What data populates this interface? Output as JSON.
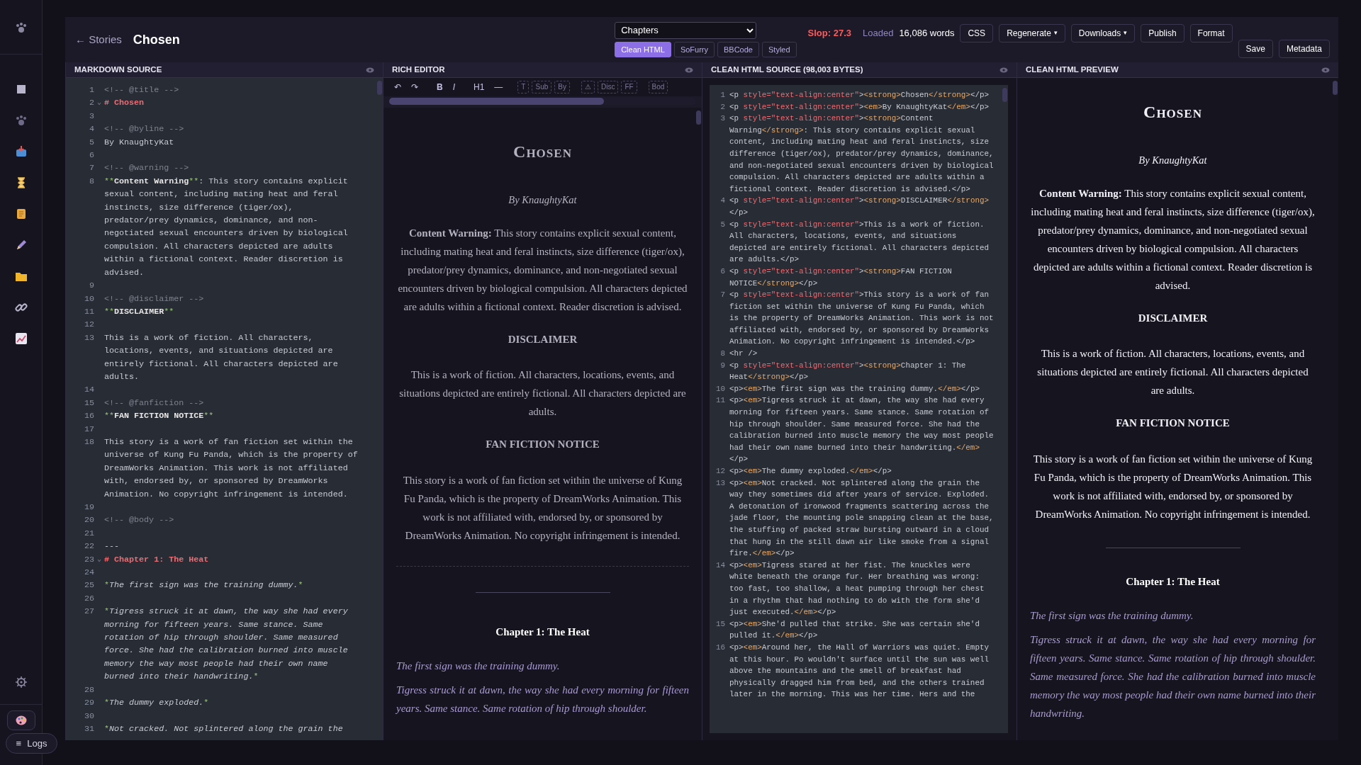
{
  "header": {
    "back_link": "← Stories",
    "title": "Chosen",
    "format_select": "Chapters",
    "format_tabs": [
      {
        "label": "Clean HTML",
        "selected": true
      },
      {
        "label": "SoFurry",
        "selected": false
      },
      {
        "label": "BBCode",
        "selected": false
      },
      {
        "label": "Styled",
        "selected": false
      }
    ],
    "slop": "Slop: 27.3",
    "status": "Loaded",
    "word_count": "16,086 words",
    "buttons": [
      {
        "label": "CSS"
      },
      {
        "label": "Regenerate",
        "caret": "▾"
      },
      {
        "label": "Downloads",
        "caret": "▾"
      },
      {
        "label": "Publish"
      },
      {
        "label": "Format"
      }
    ],
    "end_buttons": [
      {
        "label": "Save"
      },
      {
        "label": "Metadata"
      }
    ]
  },
  "sidebar": {
    "logs_icon": "≡",
    "logs_label": "Logs"
  },
  "markdown": {
    "title": "MARKDOWN SOURCE",
    "lines": [
      {
        "n": "1",
        "parts": [
          {
            "kind": "comment",
            "text": "<!-- @title -->"
          }
        ]
      },
      {
        "n": "2",
        "fold": "⌄",
        "parts": [
          {
            "kind": "h",
            "text": "# Chosen"
          }
        ]
      },
      {
        "n": "3"
      },
      {
        "n": "4",
        "parts": [
          {
            "kind": "comment",
            "text": "<!-- @byline -->"
          }
        ]
      },
      {
        "n": "5",
        "parts": [
          {
            "kind": "text",
            "text": "By KnaughtyKat"
          }
        ]
      },
      {
        "n": "6"
      },
      {
        "n": "7",
        "parts": [
          {
            "kind": "comment",
            "text": "<!-- @warning -->"
          }
        ]
      },
      {
        "n": "8",
        "parts": [
          {
            "kind": "mark",
            "text": "**"
          },
          {
            "kind": "strong",
            "text": "Content Warning"
          },
          {
            "kind": "mark",
            "text": "**"
          },
          {
            "kind": "text",
            "text": ": This story contains explicit sexual content, including mating heat and feral instincts, size difference (tiger/ox), predator/prey dynamics, dominance, and non-negotiated sexual encounters driven by biological compulsion. All characters depicted are adults within a fictional context. Reader discretion is advised."
          }
        ]
      },
      {
        "n": "9"
      },
      {
        "n": "10",
        "parts": [
          {
            "kind": "comment",
            "text": "<!-- @disclaimer -->"
          }
        ]
      },
      {
        "n": "11",
        "parts": [
          {
            "kind": "mark",
            "text": "**"
          },
          {
            "kind": "strong",
            "text": "DISCLAIMER"
          },
          {
            "kind": "mark",
            "text": "**"
          }
        ]
      },
      {
        "n": "12"
      },
      {
        "n": "13",
        "parts": [
          {
            "kind": "text",
            "text": "This is a work of fiction. All characters, locations, events, and situations depicted are entirely fictional. All characters depicted are adults."
          }
        ]
      },
      {
        "n": "14"
      },
      {
        "n": "15",
        "parts": [
          {
            "kind": "comment",
            "text": "<!-- @fanfiction -->"
          }
        ]
      },
      {
        "n": "16",
        "parts": [
          {
            "kind": "mark",
            "text": "**"
          },
          {
            "kind": "strong",
            "text": "FAN FICTION NOTICE"
          },
          {
            "kind": "mark",
            "text": "**"
          }
        ]
      },
      {
        "n": "17"
      },
      {
        "n": "18",
        "parts": [
          {
            "kind": "text",
            "text": "This story is a work of fan fiction set within the universe of Kung Fu Panda, which is the property of DreamWorks Animation. This work is not affiliated with, endorsed by, or sponsored by DreamWorks Animation. No copyright infringement is intended."
          }
        ]
      },
      {
        "n": "19"
      },
      {
        "n": "20",
        "parts": [
          {
            "kind": "comment",
            "text": "<!-- @body -->"
          }
        ]
      },
      {
        "n": "21"
      },
      {
        "n": "22",
        "parts": [
          {
            "kind": "text",
            "text": "---"
          }
        ]
      },
      {
        "n": "23",
        "fold": "⌄",
        "parts": [
          {
            "kind": "h",
            "text": "# Chapter 1: The Heat"
          }
        ]
      },
      {
        "n": "24"
      },
      {
        "n": "25",
        "parts": [
          {
            "kind": "mark",
            "text": "*"
          },
          {
            "kind": "em",
            "text": "The first sign was the training dummy."
          },
          {
            "kind": "mark",
            "text": "*"
          }
        ]
      },
      {
        "n": "26"
      },
      {
        "n": "27",
        "parts": [
          {
            "kind": "mark",
            "text": "*"
          },
          {
            "kind": "em",
            "text": "Tigress struck it at dawn, the way she had every morning for fifteen years. Same stance. Same rotation of hip through shoulder. Same measured force. She had the calibration burned into muscle memory the way most people had their own name burned into their handwriting."
          },
          {
            "kind": "mark",
            "text": "*"
          }
        ]
      },
      {
        "n": "28"
      },
      {
        "n": "29",
        "parts": [
          {
            "kind": "mark",
            "text": "*"
          },
          {
            "kind": "em",
            "text": "The dummy exploded."
          },
          {
            "kind": "mark",
            "text": "*"
          }
        ]
      },
      {
        "n": "30"
      },
      {
        "n": "31",
        "parts": [
          {
            "kind": "mark",
            "text": "*"
          },
          {
            "kind": "em",
            "text": "Not cracked. Not splintered along the grain the"
          }
        ]
      }
    ]
  },
  "rich_editor": {
    "title": "RICH EDITOR",
    "toolbar": [
      [
        {
          "label": "↶",
          "kind": "plain"
        },
        {
          "label": "↷",
          "kind": "plain"
        }
      ],
      [
        {
          "label": "B",
          "kind": "bold"
        },
        {
          "label": "I",
          "kind": "italic"
        }
      ],
      [
        {
          "label": "H1",
          "kind": "plain"
        },
        {
          "label": "—",
          "kind": "plain"
        }
      ],
      [
        {
          "label": "T",
          "kind": "dashed"
        },
        {
          "label": "Sub",
          "kind": "dashed"
        },
        {
          "label": "By",
          "kind": "dashed"
        }
      ],
      [
        {
          "label": "⚠",
          "kind": "dashed"
        },
        {
          "label": "Disc",
          "kind": "dashed"
        },
        {
          "label": "FF",
          "kind": "dashed"
        }
      ],
      [
        {
          "label": "Bod",
          "kind": "dashed"
        }
      ]
    ],
    "doc": [
      {
        "kind": "title",
        "text": "Chosen"
      },
      {
        "kind": "byline",
        "text": "By KnaughtyKat"
      },
      {
        "kind": "para",
        "text": "**Content Warning:** This story contains explicit sexual content, including mating heat and feral instincts, size difference (tiger/ox), predator/prey dynamics, dominance, and non-negotiated sexual encounters driven by biological compulsion. All characters depicted are adults within a fictional context. Reader discretion is advised."
      },
      {
        "kind": "heading",
        "text": "DISCLAIMER"
      },
      {
        "kind": "para",
        "text": "This is a work of fiction. All characters, locations, events, and situations depicted are entirely fictional. All characters depicted are adults."
      },
      {
        "kind": "heading",
        "text": "FAN FICTION NOTICE"
      },
      {
        "kind": "para",
        "text": "This story is a work of fan fiction set within the universe of Kung Fu Panda, which is the property of DreamWorks Animation. This work is not affiliated with, endorsed by, or sponsored by DreamWorks Animation. No copyright infringement is intended."
      },
      {
        "kind": "page_break"
      },
      {
        "kind": "rule"
      },
      {
        "kind": "chapter",
        "text": "Chapter 1: The Heat"
      },
      {
        "kind": "italic",
        "text": "The first sign was the training dummy."
      },
      {
        "kind": "italic",
        "text": "Tigress struck it at dawn, the way she had every morning for fifteen years. Same stance. Same rotation of hip through shoulder."
      }
    ]
  },
  "html_source": {
    "title": "CLEAN HTML SOURCE (98,003 BYTES)",
    "lines": [
      {
        "n": "1",
        "parts": [
          {
            "kind": "plain",
            "text": "<p "
          },
          {
            "kind": "attr",
            "text": "style=\"text-align:center\""
          },
          {
            "kind": "plain",
            "text": ">"
          },
          {
            "kind": "el",
            "text": "<strong>"
          },
          {
            "kind": "plain",
            "text": "Chosen"
          },
          {
            "kind": "el",
            "text": "</strong>"
          },
          {
            "kind": "plain",
            "text": "</p>"
          }
        ]
      },
      {
        "n": "2",
        "parts": [
          {
            "kind": "plain",
            "text": "<p "
          },
          {
            "kind": "attr",
            "text": "style=\"text-align:center\""
          },
          {
            "kind": "plain",
            "text": ">"
          },
          {
            "kind": "el",
            "text": "<em>"
          },
          {
            "kind": "plain",
            "text": "By KnaughtyKat"
          },
          {
            "kind": "el",
            "text": "</em>"
          },
          {
            "kind": "plain",
            "text": "</p>"
          }
        ]
      },
      {
        "n": "3",
        "parts": [
          {
            "kind": "plain",
            "text": "<p "
          },
          {
            "kind": "attr",
            "text": "style=\"text-align:center\""
          },
          {
            "kind": "plain",
            "text": ">"
          },
          {
            "kind": "el",
            "text": "<strong>"
          },
          {
            "kind": "plain",
            "text": "Content Warning"
          },
          {
            "kind": "el",
            "text": "</strong>"
          },
          {
            "kind": "plain",
            "text": ": This story contains explicit sexual content, including mating heat and feral instincts, size difference (tiger/ox), predator/prey dynamics, dominance, and non-negotiated sexual encounters driven by biological compulsion. All characters depicted are adults within a fictional context. Reader discretion is advised.</p>"
          }
        ]
      },
      {
        "n": "4",
        "parts": [
          {
            "kind": "plain",
            "text": "<p "
          },
          {
            "kind": "attr",
            "text": "style=\"text-align:center\""
          },
          {
            "kind": "plain",
            "text": ">"
          },
          {
            "kind": "el",
            "text": "<strong>"
          },
          {
            "kind": "plain",
            "text": "DISCLAIMER"
          },
          {
            "kind": "el",
            "text": "</strong>"
          },
          {
            "kind": "plain",
            "text": "</p>"
          }
        ]
      },
      {
        "n": "5",
        "parts": [
          {
            "kind": "plain",
            "text": "<p "
          },
          {
            "kind": "attr",
            "text": "style=\"text-align:center\""
          },
          {
            "kind": "plain",
            "text": ">This is a work of fiction. All characters, locations, events, and situations depicted are entirely fictional. All characters depicted are adults.</p>"
          }
        ]
      },
      {
        "n": "6",
        "parts": [
          {
            "kind": "plain",
            "text": "<p "
          },
          {
            "kind": "attr",
            "text": "style=\"text-align:center\""
          },
          {
            "kind": "plain",
            "text": ">"
          },
          {
            "kind": "el",
            "text": "<strong>"
          },
          {
            "kind": "plain",
            "text": "FAN FICTION NOTICE"
          },
          {
            "kind": "el",
            "text": "</strong>"
          },
          {
            "kind": "plain",
            "text": "</p>"
          }
        ]
      },
      {
        "n": "7",
        "parts": [
          {
            "kind": "plain",
            "text": "<p "
          },
          {
            "kind": "attr",
            "text": "style=\"text-align:center\""
          },
          {
            "kind": "plain",
            "text": ">This story is a work of fan fiction set within the universe of Kung Fu Panda, which is the property of DreamWorks Animation. This work is not affiliated with, endorsed by, or sponsored by DreamWorks Animation. No copyright infringement is intended.</p>"
          }
        ]
      },
      {
        "n": "8",
        "parts": [
          {
            "kind": "plain",
            "text": "<hr />"
          }
        ]
      },
      {
        "n": "9",
        "parts": [
          {
            "kind": "plain",
            "text": "<p "
          },
          {
            "kind": "attr",
            "text": "style=\"text-align:center\""
          },
          {
            "kind": "plain",
            "text": ">"
          },
          {
            "kind": "el",
            "text": "<strong>"
          },
          {
            "kind": "plain",
            "text": "Chapter 1: The Heat"
          },
          {
            "kind": "el",
            "text": "</strong>"
          },
          {
            "kind": "plain",
            "text": "</p>"
          }
        ]
      },
      {
        "n": "10",
        "parts": [
          {
            "kind": "plain",
            "text": "<p>"
          },
          {
            "kind": "el",
            "text": "<em>"
          },
          {
            "kind": "plain",
            "text": "The first sign was the training dummy."
          },
          {
            "kind": "el",
            "text": "</em>"
          },
          {
            "kind": "plain",
            "text": "</p>"
          }
        ]
      },
      {
        "n": "11",
        "parts": [
          {
            "kind": "plain",
            "text": "<p>"
          },
          {
            "kind": "el",
            "text": "<em>"
          },
          {
            "kind": "plain",
            "text": "Tigress struck it at dawn, the way she had every morning for fifteen years. Same stance. Same rotation of hip through shoulder. Same measured force. She had the calibration burned into muscle memory the way most people had their own name burned into their handwriting."
          },
          {
            "kind": "el",
            "text": "</em>"
          },
          {
            "kind": "plain",
            "text": "</p>"
          }
        ]
      },
      {
        "n": "12",
        "parts": [
          {
            "kind": "plain",
            "text": "<p>"
          },
          {
            "kind": "el",
            "text": "<em>"
          },
          {
            "kind": "plain",
            "text": "The dummy exploded."
          },
          {
            "kind": "el",
            "text": "</em>"
          },
          {
            "kind": "plain",
            "text": "</p>"
          }
        ]
      },
      {
        "n": "13",
        "parts": [
          {
            "kind": "plain",
            "text": "<p>"
          },
          {
            "kind": "el",
            "text": "<em>"
          },
          {
            "kind": "plain",
            "text": "Not cracked. Not splintered along the grain the way they sometimes did after years of service. Exploded. A detonation of ironwood fragments scattering across the jade floor, the mounting pole snapping clean at the base, the stuffing of packed straw bursting outward in a cloud that hung in the still dawn air like smoke from a signal fire."
          },
          {
            "kind": "el",
            "text": "</em>"
          },
          {
            "kind": "plain",
            "text": "</p>"
          }
        ]
      },
      {
        "n": "14",
        "parts": [
          {
            "kind": "plain",
            "text": "<p>"
          },
          {
            "kind": "el",
            "text": "<em>"
          },
          {
            "kind": "plain",
            "text": "Tigress stared at her fist. The knuckles were white beneath the orange fur. Her breathing was wrong: too fast, too shallow, a heat pumping through her chest in a rhythm that had nothing to do with the form she'd just executed."
          },
          {
            "kind": "el",
            "text": "</em>"
          },
          {
            "kind": "plain",
            "text": "</p>"
          }
        ]
      },
      {
        "n": "15",
        "parts": [
          {
            "kind": "plain",
            "text": "<p>"
          },
          {
            "kind": "el",
            "text": "<em>"
          },
          {
            "kind": "plain",
            "text": "She'd pulled that strike. She was certain she'd pulled it."
          },
          {
            "kind": "el",
            "text": "</em>"
          },
          {
            "kind": "plain",
            "text": "</p>"
          }
        ]
      },
      {
        "n": "16",
        "parts": [
          {
            "kind": "plain",
            "text": "<p>"
          },
          {
            "kind": "el",
            "text": "<em>"
          },
          {
            "kind": "plain",
            "text": "Around her, the Hall of Warriors was quiet. Empty at this hour. Po wouldn't surface until the sun was well above the mountains and the smell of breakfast had physically dragged him from bed, and the others trained later in the morning. This was her time. Hers and the"
          }
        ]
      }
    ]
  },
  "preview": {
    "title": "CLEAN HTML PREVIEW",
    "doc": [
      {
        "kind": "title",
        "text": "Chosen"
      },
      {
        "kind": "byline",
        "text": "By KnaughtyKat"
      },
      {
        "kind": "para",
        "text": "**Content Warning:** This story contains explicit sexual content, including mating heat and feral instincts, size difference (tiger/ox), predator/prey dynamics, dominance, and non-negotiated sexual encounters driven by biological compulsion. All characters depicted are adults within a fictional context. Reader discretion is advised."
      },
      {
        "kind": "heading",
        "text": "DISCLAIMER"
      },
      {
        "kind": "para",
        "text": "This is a work of fiction. All characters, locations, events, and situations depicted are entirely fictional. All characters depicted are adults."
      },
      {
        "kind": "heading",
        "text": "FAN FICTION NOTICE"
      },
      {
        "kind": "para",
        "text": "This story is a work of fan fiction set within the universe of Kung Fu Panda, which is the property of DreamWorks Animation. This work is not affiliated with, endorsed by, or sponsored by DreamWorks Animation. No copyright infringement is intended."
      },
      {
        "kind": "rule"
      },
      {
        "kind": "chapter",
        "text": "Chapter 1: The Heat"
      },
      {
        "kind": "italic",
        "text": "The first sign was the training dummy."
      },
      {
        "kind": "italic",
        "text": "Tigress struck it at dawn, the way she had every morning for fifteen years. Same stance. Same rotation of hip through shoulder. Same measured force. She had the calibration burned into muscle memory the way most people had their own name burned into their handwriting."
      }
    ]
  }
}
